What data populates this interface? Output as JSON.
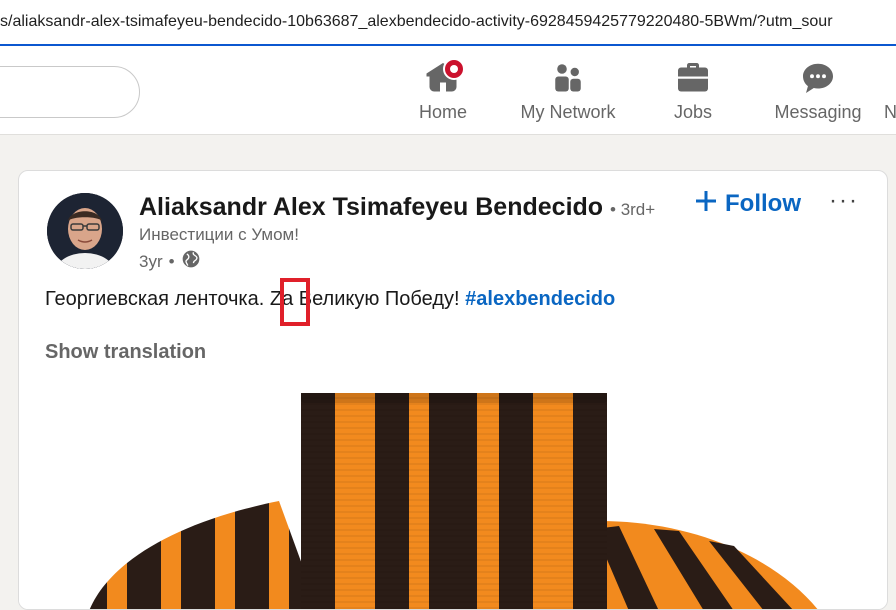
{
  "browser": {
    "url": "s/aliaksandr-alex-tsimafeyeu-bendecido-10b63687_alexbendecido-activity-6928459425779220480-5BWm/?utm_sour"
  },
  "nav": {
    "items": [
      {
        "label": "Home",
        "icon": "home-icon"
      },
      {
        "label": "My Network",
        "icon": "people-icon"
      },
      {
        "label": "Jobs",
        "icon": "briefcase-icon"
      },
      {
        "label": "Messaging",
        "icon": "chat-icon"
      },
      {
        "label": "N",
        "icon": "bell-icon"
      }
    ]
  },
  "post": {
    "author": "Aliaksandr Alex Tsimafeyeu Bendecido",
    "degree": "• 3rd+",
    "headline": "Инвестиции с Умом!",
    "time": "3yr",
    "time_sep": "•",
    "visibility_icon": "globe-icon",
    "follow_label": "Follow",
    "more_label": "···",
    "text_before": "Георгиевская ленточка. ",
    "text_highlight": "Za",
    "text_after": " Великую Победу! ",
    "hashtag": "#alexbendecido",
    "show_translation": "Show translation"
  },
  "colors": {
    "accent": "#0a66c2",
    "notification": "#cb112d",
    "highlight_box": "#e0202a",
    "ribbon_orange": "#f28a1e",
    "ribbon_black": "#2a1c16"
  }
}
